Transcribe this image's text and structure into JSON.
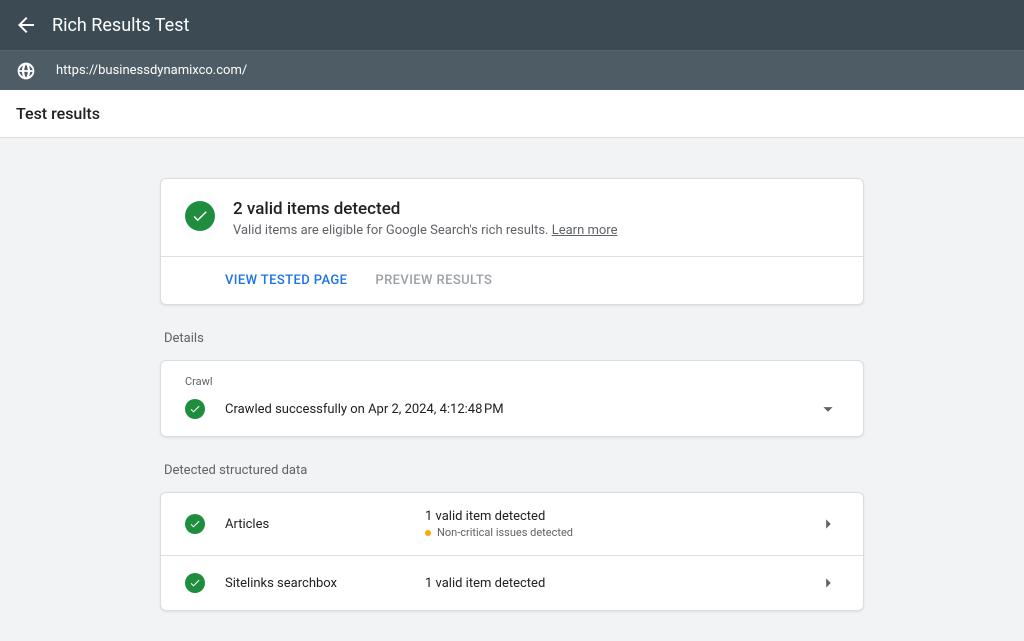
{
  "header": {
    "title": "Rich Results Test",
    "url": "https://businessdynamixco.com/"
  },
  "section_title": "Test results",
  "summary": {
    "headline": "2 valid items detected",
    "subtext": "Valid items are eligible for Google Search's rich results. ",
    "learn_more": "Learn more",
    "view_tested": "VIEW TESTED PAGE",
    "preview_results": "PREVIEW RESULTS"
  },
  "details_label": "Details",
  "crawl": {
    "label": "Crawl",
    "status": "Crawled successfully on Apr 2, 2024, 4:12:48 PM"
  },
  "detected_label": "Detected structured data",
  "items": {
    "articles": {
      "name": "Articles",
      "status": "1 valid item detected",
      "warning": "Non-critical issues detected"
    },
    "sitelinks": {
      "name": "Sitelinks searchbox",
      "status": "1 valid item detected"
    }
  }
}
